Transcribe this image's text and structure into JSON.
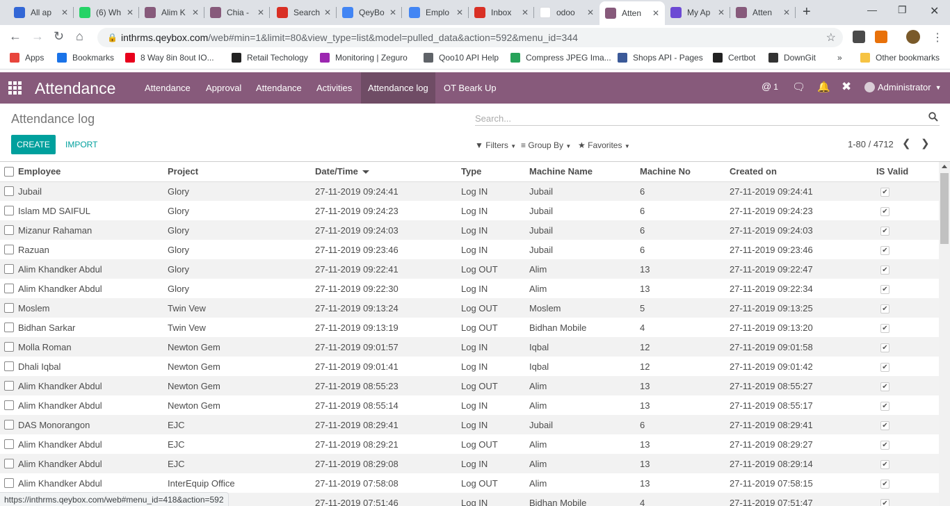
{
  "browser": {
    "tabs": [
      {
        "label": "All ap",
        "icon": "tab-icon-generic",
        "color": "#3367d6"
      },
      {
        "label": "(6) Wh",
        "icon": "whatsapp-icon",
        "color": "#25d366"
      },
      {
        "label": "Alim K",
        "icon": "odoo-icon",
        "color": "#875a7b"
      },
      {
        "label": "Chia -",
        "icon": "odoo-icon",
        "color": "#875a7b"
      },
      {
        "label": "Search",
        "icon": "gmail-icon",
        "color": "#d93025"
      },
      {
        "label": "QeyBo",
        "icon": "docs-icon",
        "color": "#4285f4"
      },
      {
        "label": "Emplo",
        "icon": "docs-icon",
        "color": "#4285f4"
      },
      {
        "label": "Inbox",
        "icon": "gmail-icon",
        "color": "#d93025"
      },
      {
        "label": "odoo",
        "icon": "google-icon",
        "color": "#ffffff"
      },
      {
        "label": "Atten",
        "icon": "odoo-icon",
        "color": "#875a7b"
      },
      {
        "label": "My Ap",
        "icon": "app-icon",
        "color": "#6c4ad4"
      },
      {
        "label": "Atten",
        "icon": "odoo-icon",
        "color": "#875a7b"
      }
    ],
    "active_tab_index": 9,
    "url_host": "inthrms.qeybox.com",
    "url_rest": "/web#min=1&limit=80&view_type=list&model=pulled_data&action=592&menu_id=344",
    "bookmarks": [
      {
        "label": "Apps"
      },
      {
        "label": "Bookmarks"
      },
      {
        "label": "8 Way 8in 8out IO..."
      },
      {
        "label": "Retail Techology"
      },
      {
        "label": "Monitoring | Zeguro"
      },
      {
        "label": "Qoo10 API Help"
      },
      {
        "label": "Compress JPEG Ima..."
      },
      {
        "label": "Shops API - Pages"
      },
      {
        "label": "Certbot"
      },
      {
        "label": "DownGit"
      }
    ],
    "more_bookmarks": "»",
    "other_bookmarks": "Other bookmarks",
    "status_url": "https://inthrms.qeybox.com/web#menu_id=418&action=592"
  },
  "app": {
    "brand": "Attendance",
    "menu": [
      {
        "label": "Attendance"
      },
      {
        "label": "Approval"
      },
      {
        "label": "Attendance"
      },
      {
        "label": "Activities"
      },
      {
        "label": "Attendance log"
      },
      {
        "label": "OT Beark Up"
      }
    ],
    "mentions_count": "1",
    "user": "Administrator"
  },
  "control_panel": {
    "breadcrumb": "Attendance log",
    "create_label": "CREATE",
    "import_label": "IMPORT",
    "search_placeholder": "Search...",
    "filters_label": "Filters",
    "groupby_label": "Group By",
    "favorites_label": "Favorites",
    "pager": "1-80 / 4712"
  },
  "table": {
    "columns": [
      "Employee",
      "Project",
      "Date/Time",
      "Type",
      "Machine Name",
      "Machine No",
      "Created on",
      "IS Valid"
    ],
    "rows": [
      [
        "Jubail",
        "Glory",
        "27-11-2019 09:24:41",
        "Log IN",
        "Jubail",
        "6",
        "27-11-2019 09:24:41"
      ],
      [
        "Islam MD SAIFUL",
        "Glory",
        "27-11-2019 09:24:23",
        "Log IN",
        "Jubail",
        "6",
        "27-11-2019 09:24:23"
      ],
      [
        "Mizanur Rahaman",
        "Glory",
        "27-11-2019 09:24:03",
        "Log IN",
        "Jubail",
        "6",
        "27-11-2019 09:24:03"
      ],
      [
        "Razuan",
        "Glory",
        "27-11-2019 09:23:46",
        "Log IN",
        "Jubail",
        "6",
        "27-11-2019 09:23:46"
      ],
      [
        "Alim Khandker Abdul",
        "Glory",
        "27-11-2019 09:22:41",
        "Log OUT",
        "Alim",
        "13",
        "27-11-2019 09:22:47"
      ],
      [
        "Alim Khandker Abdul",
        "Glory",
        "27-11-2019 09:22:30",
        "Log IN",
        "Alim",
        "13",
        "27-11-2019 09:22:34"
      ],
      [
        "Moslem",
        "Twin Vew",
        "27-11-2019 09:13:24",
        "Log OUT",
        "Moslem",
        "5",
        "27-11-2019 09:13:25"
      ],
      [
        "Bidhan Sarkar",
        "Twin Vew",
        "27-11-2019 09:13:19",
        "Log OUT",
        "Bidhan Mobile",
        "4",
        "27-11-2019 09:13:20"
      ],
      [
        "Molla Roman",
        "Newton Gem",
        "27-11-2019 09:01:57",
        "Log IN",
        "Iqbal",
        "12",
        "27-11-2019 09:01:58"
      ],
      [
        "Dhali Iqbal",
        "Newton Gem",
        "27-11-2019 09:01:41",
        "Log IN",
        "Iqbal",
        "12",
        "27-11-2019 09:01:42"
      ],
      [
        "Alim Khandker Abdul",
        "Newton Gem",
        "27-11-2019 08:55:23",
        "Log OUT",
        "Alim",
        "13",
        "27-11-2019 08:55:27"
      ],
      [
        "Alim Khandker Abdul",
        "Newton Gem",
        "27-11-2019 08:55:14",
        "Log IN",
        "Alim",
        "13",
        "27-11-2019 08:55:17"
      ],
      [
        "DAS Monorangon",
        "EJC",
        "27-11-2019 08:29:41",
        "Log IN",
        "Jubail",
        "6",
        "27-11-2019 08:29:41"
      ],
      [
        "Alim Khandker Abdul",
        "EJC",
        "27-11-2019 08:29:21",
        "Log OUT",
        "Alim",
        "13",
        "27-11-2019 08:29:27"
      ],
      [
        "Alim Khandker Abdul",
        "EJC",
        "27-11-2019 08:29:08",
        "Log IN",
        "Alim",
        "13",
        "27-11-2019 08:29:14"
      ],
      [
        "Alim Khandker Abdul",
        "InterEquip Office",
        "27-11-2019 07:58:08",
        "Log OUT",
        "Alim",
        "13",
        "27-11-2019 07:58:15"
      ],
      [
        "",
        "",
        "27-11-2019 07:51:46",
        "Log IN",
        "Bidhan Mobile",
        "4",
        "27-11-2019 07:51:47"
      ]
    ]
  },
  "colors": {
    "brand": "#875a7b",
    "brand_active": "#6f4c65",
    "primary_button": "#00a09d"
  }
}
